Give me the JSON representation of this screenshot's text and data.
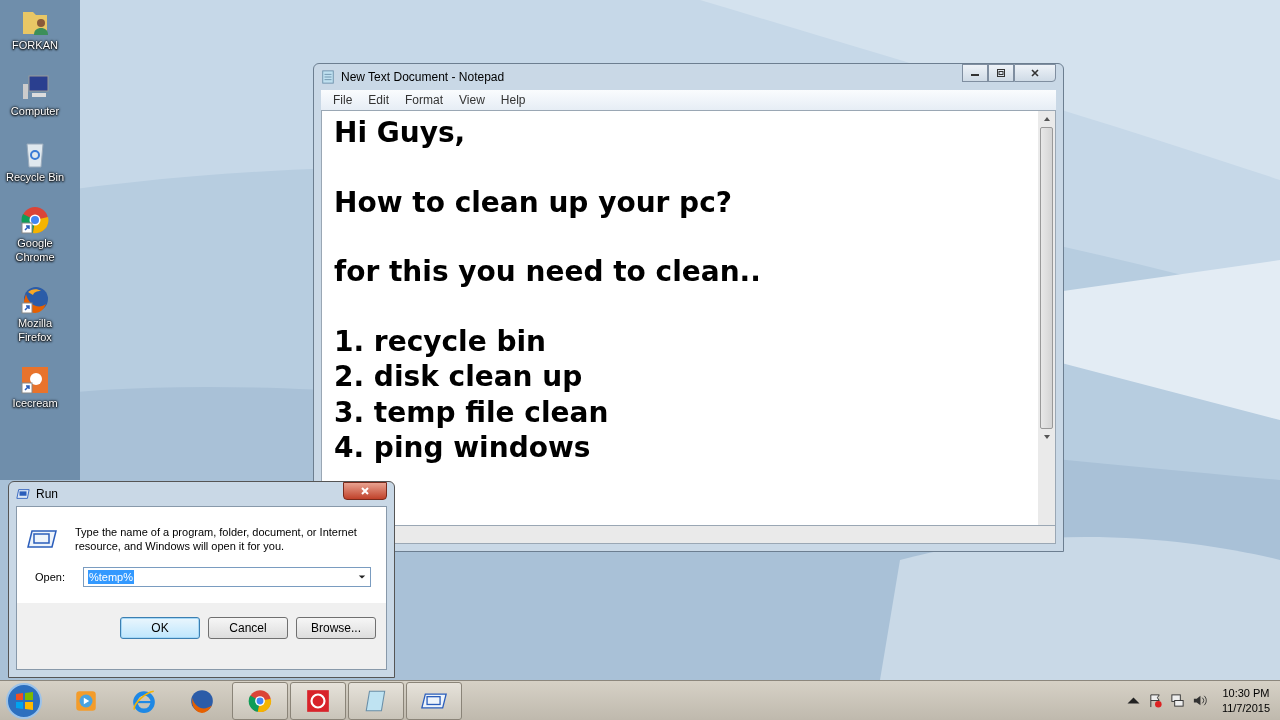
{
  "desktop_icons": [
    {
      "kind": "user-folder",
      "label": "FORKAN"
    },
    {
      "kind": "computer",
      "label": "Computer"
    },
    {
      "kind": "recycle-bin",
      "label": "Recycle Bin"
    },
    {
      "kind": "chrome",
      "label": "Google Chrome"
    },
    {
      "kind": "firefox",
      "label": "Mozilla Firefox"
    },
    {
      "kind": "icecream",
      "label": "Icecream"
    }
  ],
  "notepad": {
    "title": "New Text Document - Notepad",
    "menu": [
      "File",
      "Edit",
      "Format",
      "View",
      "Help"
    ],
    "paragraphs": [
      [
        "Hi Guys,"
      ],
      [
        "How to clean up your pc?"
      ],
      [
        "for this you need to clean.."
      ],
      [
        "1. recycle bin",
        "2. disk clean up",
        "3. temp file clean",
        "4. ping windows"
      ]
    ]
  },
  "run_dialog": {
    "title": "Run",
    "description": "Type the name of a program, folder, document, or Internet resource, and Windows will open it for you.",
    "open_label": "Open:",
    "value": "%temp%",
    "value_selected": true,
    "buttons": [
      {
        "label": "OK",
        "default": true
      },
      {
        "label": "Cancel",
        "default": false
      },
      {
        "label": "Browse...",
        "default": false
      }
    ]
  },
  "taskbar": {
    "items": [
      {
        "kind": "media",
        "active": false
      },
      {
        "kind": "ie",
        "active": false
      },
      {
        "kind": "firefox",
        "active": false
      },
      {
        "kind": "chrome",
        "active": true
      },
      {
        "kind": "icecream",
        "active": true
      },
      {
        "kind": "notepad",
        "active": true
      },
      {
        "kind": "run",
        "active": true
      }
    ],
    "time": "10:30 PM",
    "date": "11/7/2015"
  }
}
